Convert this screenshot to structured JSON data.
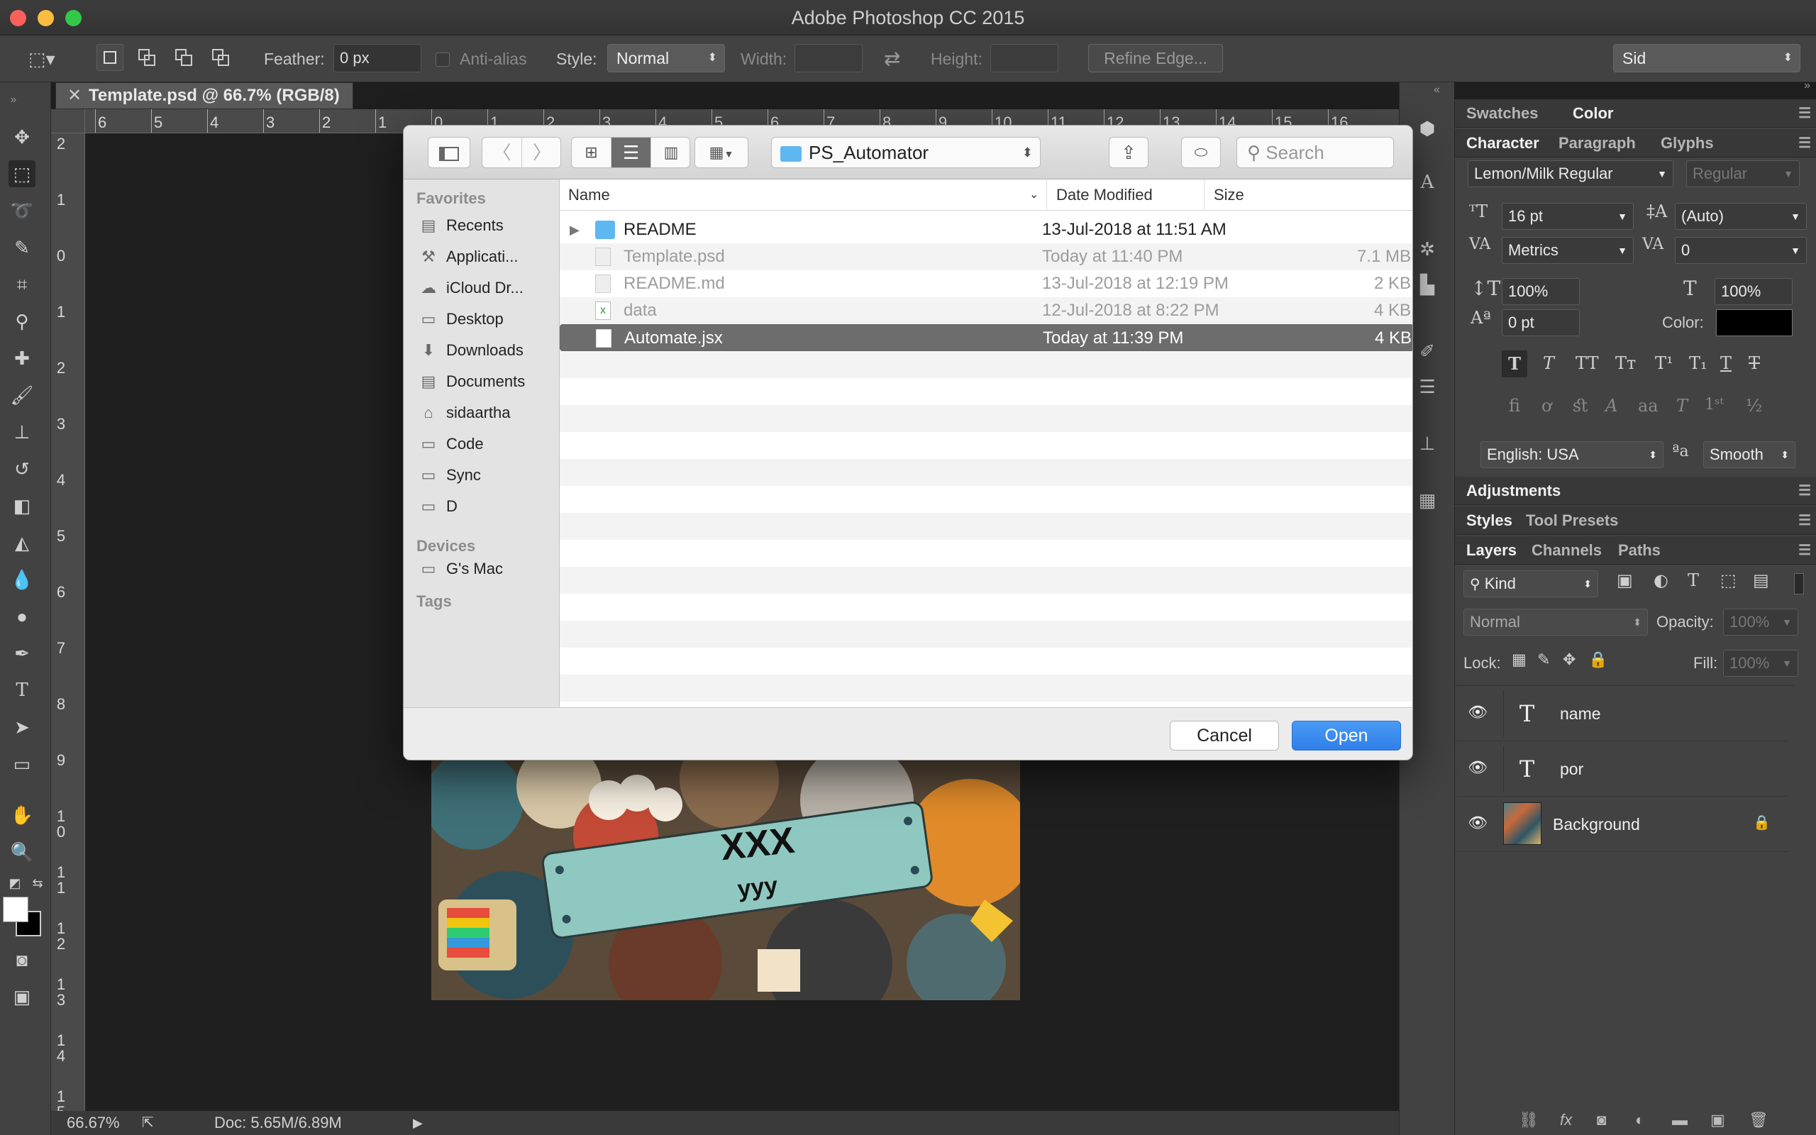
{
  "window": {
    "title": "Adobe Photoshop CC 2015"
  },
  "options_bar": {
    "feather_label": "Feather:",
    "feather_value": "0 px",
    "antialias_label": "Anti-alias",
    "style_label": "Style:",
    "style_value": "Normal",
    "width_label": "Width:",
    "height_label": "Height:",
    "refine_edge": "Refine Edge...",
    "workspace": "Sid"
  },
  "document": {
    "tab_title": "Template.psd @ 66.7% (RGB/8)",
    "ruler_h": [
      "6",
      "5",
      "4",
      "3",
      "2",
      "1",
      "0",
      "1",
      "2",
      "3",
      "4",
      "5",
      "6",
      "7",
      "8",
      "9",
      "10",
      "11",
      "12",
      "13",
      "14",
      "15",
      "16"
    ],
    "ruler_v": [
      "2",
      "1",
      "0",
      "1",
      "2",
      "3",
      "4",
      "5",
      "6",
      "7",
      "8",
      "9",
      "10",
      "11",
      "12",
      "13",
      "14",
      "15"
    ],
    "canvas_text_main": "XXX",
    "canvas_text_sub": "yyy"
  },
  "status_bar": {
    "zoom": "66.67%",
    "doc": "Doc: 5.65M/6.89M"
  },
  "dialog": {
    "location": "PS_Automator",
    "search_placeholder": "Search",
    "sidebar": {
      "favorites_label": "Favorites",
      "favorites": [
        {
          "label": "Recents",
          "icon": "recents-icon"
        },
        {
          "label": "Applicati...",
          "icon": "applications-icon"
        },
        {
          "label": "iCloud Dr...",
          "icon": "cloud-icon"
        },
        {
          "label": "Desktop",
          "icon": "desktop-icon"
        },
        {
          "label": "Downloads",
          "icon": "download-icon"
        },
        {
          "label": "Documents",
          "icon": "documents-icon"
        },
        {
          "label": "sidaartha",
          "icon": "home-icon"
        },
        {
          "label": "Code",
          "icon": "folder-icon"
        },
        {
          "label": "Sync",
          "icon": "folder-icon"
        },
        {
          "label": "D",
          "icon": "folder-icon"
        }
      ],
      "devices_label": "Devices",
      "devices": [
        {
          "label": "G's Mac",
          "icon": "computer-icon"
        }
      ],
      "tags_label": "Tags"
    },
    "columns": {
      "name": "Name",
      "date": "Date Modified",
      "size": "Size"
    },
    "files": [
      {
        "name": "README",
        "date": "13-Jul-2018 at 11:51 AM",
        "size": "",
        "kind": "folder"
      },
      {
        "name": "Template.psd",
        "date": "Today at 11:40 PM",
        "size": "7.1 MB",
        "kind": "psd"
      },
      {
        "name": "README.md",
        "date": "13-Jul-2018 at 12:19 PM",
        "size": "2 KB",
        "kind": "doc"
      },
      {
        "name": "data",
        "date": "12-Jul-2018 at 8:22 PM",
        "size": "4 KB",
        "kind": "sheet"
      },
      {
        "name": "Automate.jsx",
        "date": "Today at 11:39 PM",
        "size": "4 KB",
        "kind": "script"
      }
    ],
    "cancel_label": "Cancel",
    "open_label": "Open"
  },
  "panels": {
    "swatches_tab": "Swatches",
    "color_tab": "Color",
    "character_tab": "Character",
    "paragraph_tab": "Paragraph",
    "glyphs_tab": "Glyphs",
    "font_family": "Lemon/Milk Regular",
    "font_style": "Regular",
    "font_size": "16 pt",
    "leading": "(Auto)",
    "kerning": "Metrics",
    "tracking": "0",
    "vertical_scale": "100%",
    "horizontal_scale": "100%",
    "baseline_shift": "0 pt",
    "color_label": "Color:",
    "text_color": "#000000",
    "language": "English: USA",
    "antialias_method": "Smooth",
    "aa_label": "a",
    "adjustments_tab": "Adjustments",
    "styles_tab": "Styles",
    "tool_presets_tab": "Tool Presets",
    "layers_tab": "Layers",
    "channels_tab": "Channels",
    "paths_tab": "Paths",
    "filter_kind": "Kind",
    "blend_mode": "Normal",
    "opacity_label": "Opacity:",
    "opacity_value": "100%",
    "lock_label": "Lock:",
    "fill_label": "Fill:",
    "fill_value": "100%",
    "layers": [
      {
        "name": "name",
        "type": "text"
      },
      {
        "name": "por",
        "type": "text"
      },
      {
        "name": "Background",
        "type": "image",
        "locked": true
      }
    ]
  },
  "colors": {
    "accent": "#2f7fe8",
    "selected_row": "#6d6d6d",
    "folder": "#5fb7f2"
  }
}
